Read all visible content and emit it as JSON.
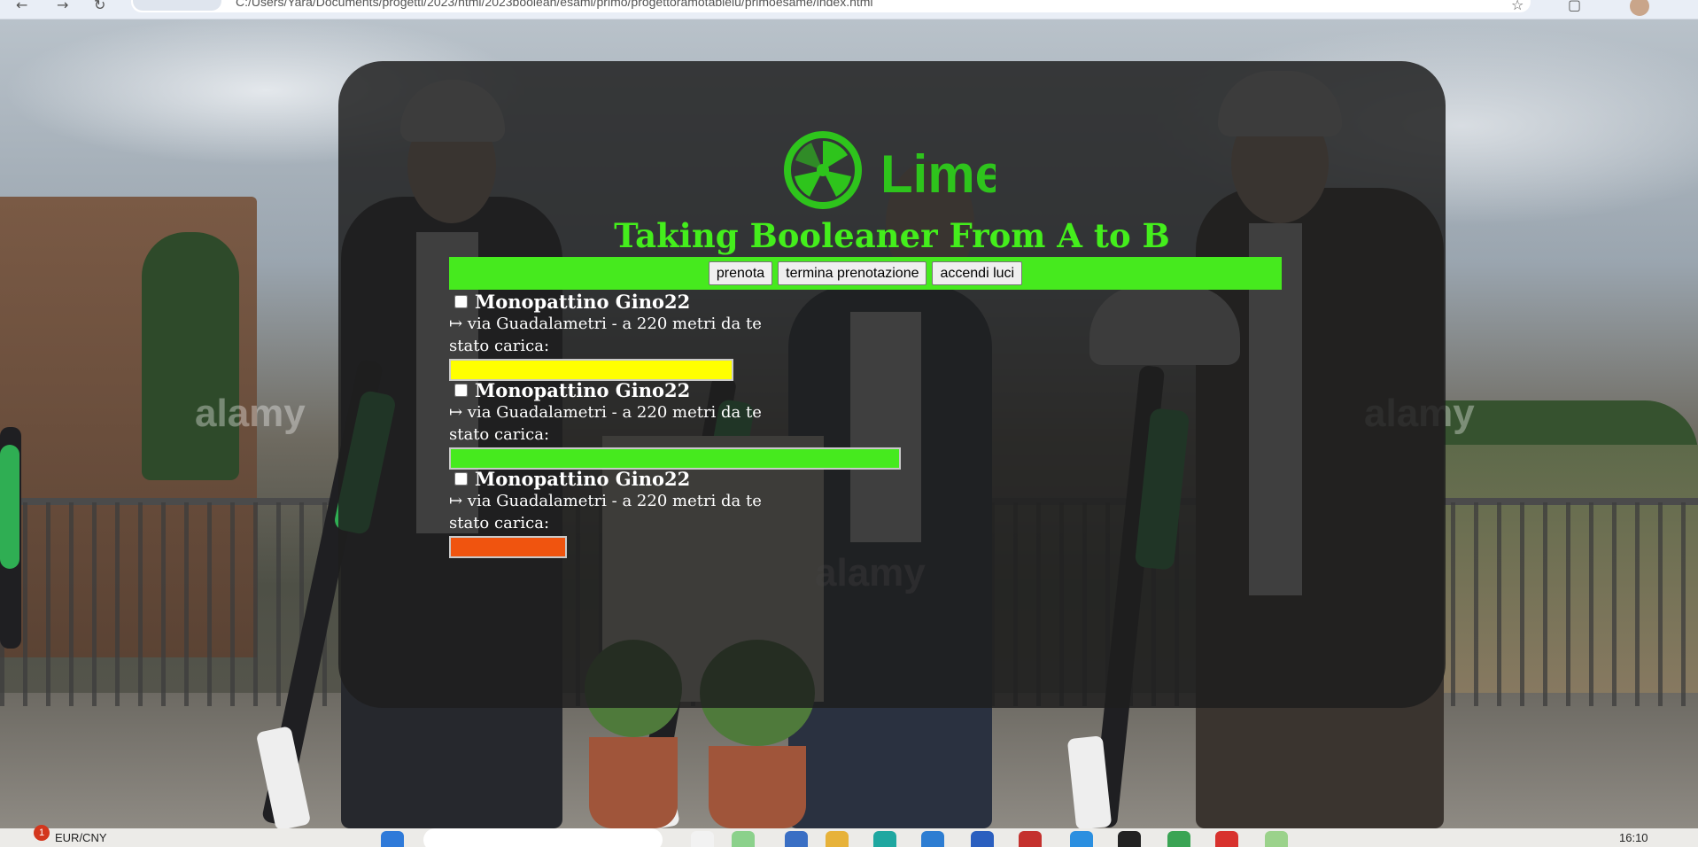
{
  "browser": {
    "address": "C:/Users/Yara/Documents/progetti/2023/html/2023boolean/esami/primo/progettoramotablelu/primoesame/index.html"
  },
  "logo": {
    "text": "Lime",
    "color": "#2ec41c"
  },
  "header": {
    "title": "Taking Booleaner From A to B",
    "title_color": "#44ee1c"
  },
  "toolbar": {
    "background": "#46ea1e",
    "buttons": {
      "book": "prenota",
      "end_booking": "termina prenotazione",
      "lights": "accendi luci"
    }
  },
  "scooters": [
    {
      "name": "Monopattino Gino22",
      "location": "↦ via Guadalametri - a 220 metri da te",
      "charge_label": "stato carica:",
      "charge_fraction": 0.63,
      "charge_color": "#ffff00"
    },
    {
      "name": "Monopattino Gino22",
      "location": "↦ via Guadalametri - a 220 metri da te",
      "charge_label": "stato carica:",
      "charge_fraction": 1.0,
      "charge_color": "#46ea1e"
    },
    {
      "name": "Monopattino Gino22",
      "location": "↦ via Guadalametri - a 220 metri da te",
      "charge_label": "stato carica:",
      "charge_fraction": 0.26,
      "charge_color": "#f0540f"
    }
  ],
  "background_watermark": "alamy",
  "taskbar": {
    "ticker": "EUR/CNY",
    "notification_count": "1",
    "clock": "16:10"
  }
}
